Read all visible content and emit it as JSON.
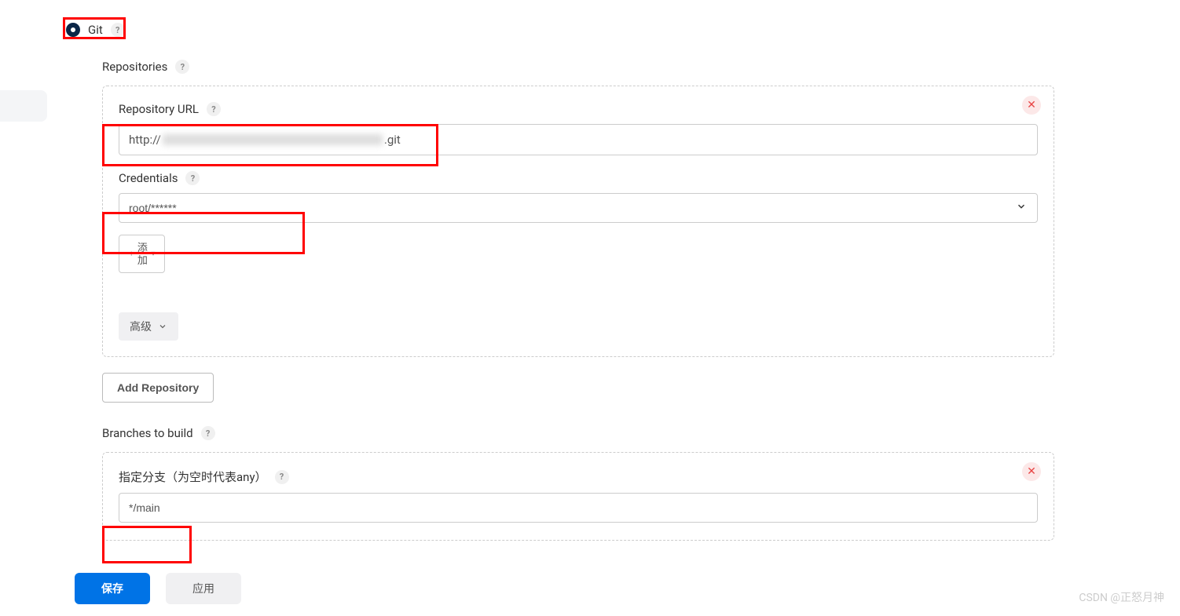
{
  "scm": {
    "git_label": "Git"
  },
  "repositories": {
    "header": "Repositories",
    "url_label": "Repository URL",
    "url_prefix": "http://",
    "url_suffix": ".git",
    "credentials_label": "Credentials",
    "credentials_value": "root/******",
    "add_button": "添加",
    "advanced_button": "高级",
    "add_repository_button": "Add Repository"
  },
  "branches": {
    "header": "Branches to build",
    "specifier_label": "指定分支（为空时代表any）",
    "specifier_value": "*/main"
  },
  "footer": {
    "save": "保存",
    "apply": "应用"
  },
  "watermark": "CSDN @正怒月神"
}
